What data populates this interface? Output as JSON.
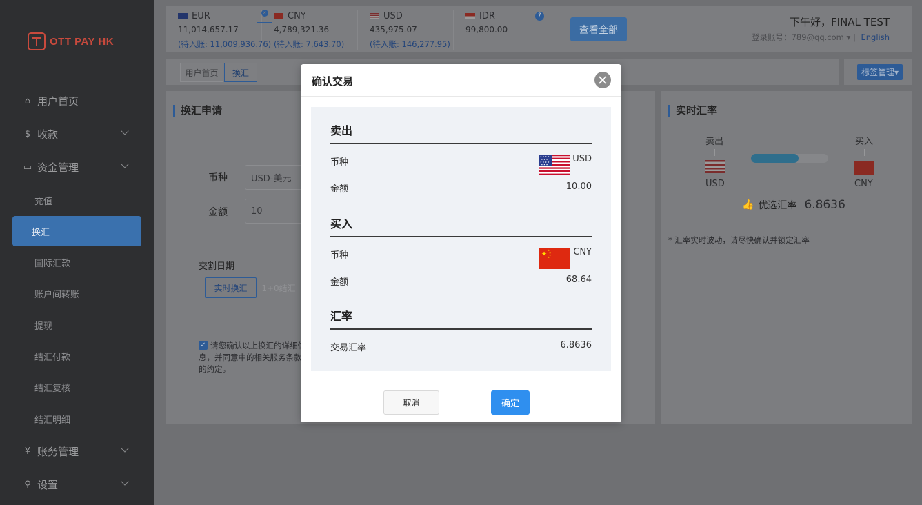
{
  "brand": {
    "name": "OTT PAY HK"
  },
  "sidebar": {
    "items": [
      {
        "label": "用户首页",
        "icon": "home-icon",
        "glyph": "⌂"
      },
      {
        "label": "收款",
        "icon": "dollar-icon",
        "glyph": "$"
      },
      {
        "label": "资金管理",
        "icon": "card-icon",
        "glyph": "▭"
      },
      {
        "label": "账务管理",
        "icon": "yen-icon",
        "glyph": "¥"
      },
      {
        "label": "设置",
        "icon": "search-icon",
        "glyph": "⚲"
      }
    ],
    "sub_items": [
      "充值",
      "换汇",
      "国际汇款",
      "账户间转账",
      "提现",
      "结汇付款",
      "结汇复核",
      "结汇明细"
    ],
    "active_sub": "换汇"
  },
  "balances": [
    {
      "code": "EUR",
      "amount": "11,014,657.17",
      "pending": "(待入账: 11,009,936.76)"
    },
    {
      "code": "CNY",
      "amount": "4,789,321.36",
      "pending": "(待入账: 7,643.70)"
    },
    {
      "code": "USD",
      "amount": "435,975.07",
      "pending": "(待入账: 146,277.95)"
    },
    {
      "code": "IDR",
      "amount": "99,800.00",
      "pending": ""
    }
  ],
  "header": {
    "help_glyph": "?",
    "view_all": "查看全部",
    "greeting": "下午好，FINAL TEST",
    "login_label": "登录账号：789@qq.com",
    "language": "English"
  },
  "tabs": {
    "home": "用户首页",
    "current": "换汇",
    "tag_manage": "标签管理▾"
  },
  "exchange_form": {
    "title": "换汇申请",
    "currency_label": "币种",
    "currency_value": "USD-美元",
    "amount_label": "金额",
    "amount_value": "10",
    "delivery_label": "交割日期",
    "option_realtime": "实时换汇",
    "option_t1": "1+0结汇",
    "agreement": "请您确认以上换汇的详细信息，并同意中的相关服务条款的约定。"
  },
  "live_rate": {
    "title": "实时汇率",
    "sell_label": "卖出",
    "buy_label": "买入",
    "sell_currency": "USD",
    "buy_currency": "CNY",
    "progress": 0.62,
    "best_rate_label": "优选汇率",
    "best_rate_value": "6.8636",
    "note": "* 汇率实时波动，请尽快确认并锁定汇率"
  },
  "modal": {
    "title": "确认交易",
    "sell_section": "卖出",
    "buy_section": "买入",
    "rate_section": "汇率",
    "currency_label": "币种",
    "amount_label": "金额",
    "rate_label": "交易汇率",
    "sell_currency": "USD",
    "sell_amount": "10.00",
    "buy_currency": "CNY",
    "buy_amount": "68.64",
    "rate_value": "6.8636",
    "cancel": "取消",
    "confirm": "确定"
  },
  "colors": {
    "primary": "#2f8fef",
    "sidebar_active": "#3a71ae",
    "brand_red": "#c94a3d"
  }
}
